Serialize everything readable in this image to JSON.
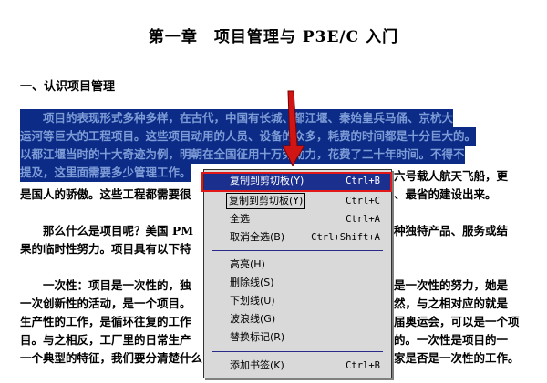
{
  "document": {
    "title": "第一章　项目管理与 P3E/C 入门",
    "section_heading": "一、认识项目管理",
    "lines": [
      {
        "text": "　　项目的表现形式多种多样，在古代，中国有长城、都江堰、秦始皇兵马俑、京杭大",
        "selected": true
      },
      {
        "text": "运河等巨大的工程项目。这些项目动用的人员、设备的众多，耗费的时间都是十分巨大的。",
        "selected": true
      },
      {
        "text": "以都江堰当时的十大奇迹为例，明朝在全国征用十万劳动力，花费了二十年时间。不得不",
        "selected": true
      },
      {
        "text": "提及，这里面需要多少管理工作。",
        "selected": true
      },
      {
        "text": "是国人的骄傲。这些工程都需要很",
        "selected": false
      },
      {
        "text": "　　那么什么是项目呢？美国 PM",
        "selected": false
      },
      {
        "text": "果的临时性努力。项目具有以下特",
        "selected": false
      },
      {
        "text": "　　一次性：项目是一次性的，独",
        "selected": false
      },
      {
        "text": "一次创新性的活动，是一个项目。",
        "selected": false
      },
      {
        "text": "生产性的工作，是循环往复的工作",
        "selected": false
      },
      {
        "text": "目。与之相反，工厂里的日常生产",
        "selected": false
      },
      {
        "text": "一个典型的特征，我们要分清楚什么",
        "selected": false
      }
    ],
    "right_fragments": [
      "六号载人航天飞船，更",
      "、最省的建设出来。",
      "种独特产品、服务或结",
      "是一次性的努力，她是",
      "然，与之相对应的就是",
      "届奥运会，可以是一个项",
      "的。一次性是项目的一",
      "家是否是一次性的工作。"
    ]
  },
  "context_menu": {
    "items": [
      {
        "label": "复制到剪切板(Y)",
        "shortcut": "Ctrl+B",
        "highlighted": true
      },
      {
        "label": "复制到剪切板(Y)",
        "shortcut": "Ctrl+C",
        "highlighted": false
      },
      {
        "label": "全选",
        "shortcut": "Ctrl+A",
        "highlighted": false
      },
      {
        "label": "取消全选(B)",
        "shortcut": "Ctrl+Shift+A",
        "highlighted": false
      },
      {
        "label": "高亮(H)",
        "shortcut": "",
        "highlighted": false
      },
      {
        "label": "删除线(S)",
        "shortcut": "",
        "highlighted": false
      },
      {
        "label": "下划线(U)",
        "shortcut": "",
        "highlighted": false
      },
      {
        "label": "波浪线(G)",
        "shortcut": "",
        "highlighted": false
      },
      {
        "label": "替换标记(R)",
        "shortcut": "",
        "highlighted": false
      },
      {
        "label": "添加书签(K)",
        "shortcut": "Ctrl+B",
        "highlighted": false
      }
    ]
  },
  "colors": {
    "selection": "#0b2b86",
    "menu_highlight": "#1b2f8f",
    "callout_red": "#e01818"
  }
}
